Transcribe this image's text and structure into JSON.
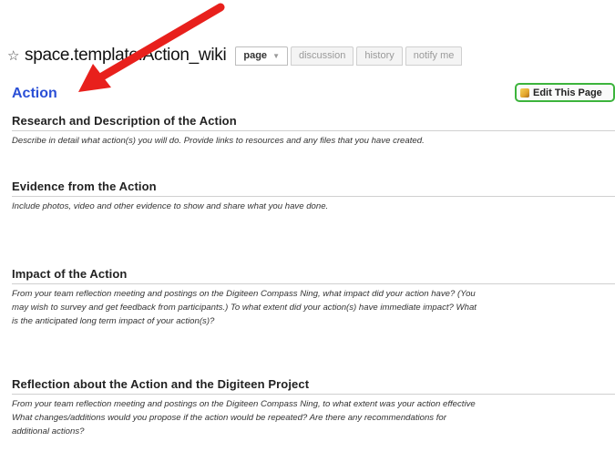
{
  "header": {
    "title": "space.template.Action_wiki",
    "star_icon": "☆",
    "tabs": [
      {
        "label": "page",
        "active": true
      },
      {
        "label": "discussion",
        "active": false
      },
      {
        "label": "history",
        "active": false
      },
      {
        "label": "notify me",
        "active": false
      }
    ]
  },
  "page": {
    "heading": "Action",
    "edit_button_label": "Edit This Page"
  },
  "sections": [
    {
      "title": "Research and Description of the Action",
      "lines": [
        "Describe in detail what action(s) you will do. Provide links to resources and any files that you have created."
      ]
    },
    {
      "title": "Evidence from the Action",
      "lines": [
        "Include photos, video and other evidence to show and share what you have done."
      ]
    },
    {
      "title": "Impact of the Action",
      "lines": [
        "From your team reflection meeting and postings on the Digiteen Compass Ning, what impact did your action have? (You",
        "may wish to survey and get feedback from participants.) To what extent did your action(s) have immediate impact? What",
        "is the anticipated long term impact of your action(s)?"
      ]
    },
    {
      "title": "Reflection about the Action and the Digiteen Project",
      "lines": [
        "From your team reflection meeting and postings on the Digiteen Compass Ning, to what extent was your action effective",
        "What changes/additions would you propose if the action would be repeated? Are there any recommendations for",
        "additional actions?"
      ]
    }
  ],
  "colors": {
    "heading_blue": "#2a4fd6",
    "edit_border_green": "#3cb43c",
    "annotation_arrow_red": "#e8201c"
  }
}
